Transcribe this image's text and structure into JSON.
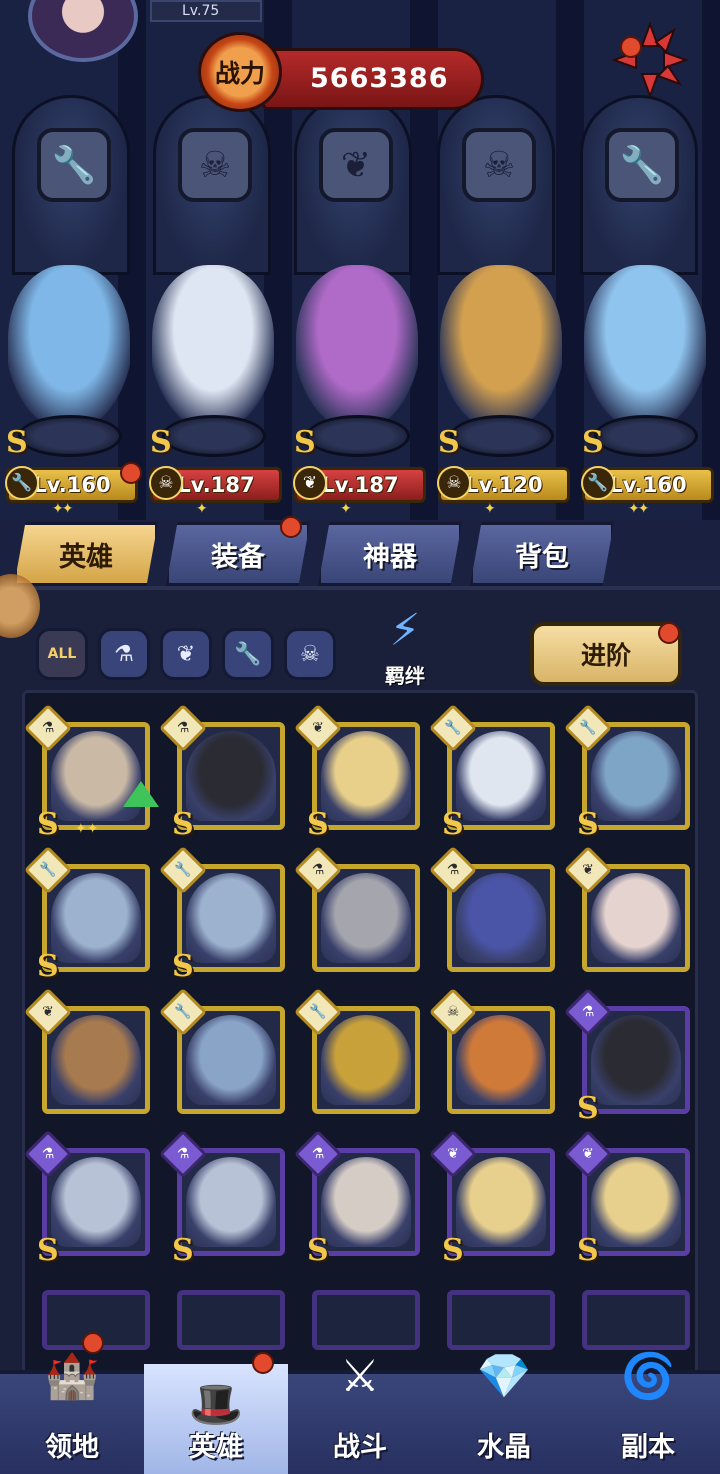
{
  "player": {
    "level": "Lv.75"
  },
  "power": {
    "label": "战力",
    "value": "5663386"
  },
  "lineup": [
    {
      "level": "Lv.160",
      "class_icon": "wrench-icon",
      "class_glyph": "🔧",
      "plate": "gold",
      "stars": "✦✦",
      "body_color": "#7fb8e8"
    },
    {
      "level": "Lv.187",
      "class_icon": "beast-mask-icon",
      "class_glyph": "☠",
      "plate": "red",
      "stars": "✦",
      "body_color": "#dfe6f3"
    },
    {
      "level": "Lv.187",
      "class_icon": "wing-icon",
      "class_glyph": "❦",
      "plate": "red",
      "stars": "✦",
      "body_color": "#b06ac8"
    },
    {
      "level": "Lv.120",
      "class_icon": "beast-mask-icon",
      "class_glyph": "☠",
      "plate": "gold",
      "stars": "✦",
      "body_color": "#d3a050"
    },
    {
      "level": "Lv.160",
      "class_icon": "wrench-icon",
      "class_glyph": "🔧",
      "plate": "gold",
      "stars": "✦✦",
      "body_color": "#8fc4ee"
    }
  ],
  "tabs": [
    {
      "label": "英雄",
      "active": true
    },
    {
      "label": "装备",
      "active": false
    },
    {
      "label": "神器",
      "active": false
    },
    {
      "label": "背包",
      "active": false
    }
  ],
  "filters": [
    {
      "icon": "all-filter-icon",
      "glyph": "ALL"
    },
    {
      "icon": "flask-filter-icon",
      "glyph": "⚗"
    },
    {
      "icon": "wing-filter-icon",
      "glyph": "❦"
    },
    {
      "icon": "wrench-filter-icon",
      "glyph": "🔧"
    },
    {
      "icon": "beast-filter-icon",
      "glyph": "☠"
    }
  ],
  "bond": {
    "label": "羁绊"
  },
  "advance": {
    "label": "进阶"
  },
  "heroes": [
    {
      "class": "flask",
      "tier": "gold",
      "s": true,
      "stars": "✦✦",
      "upgrade": true,
      "color": "#c9b9a5"
    },
    {
      "class": "flask",
      "tier": "gold",
      "s": true,
      "stars": "",
      "upgrade": false,
      "color": "#2b2b33"
    },
    {
      "class": "wing",
      "tier": "gold",
      "s": true,
      "stars": "",
      "upgrade": false,
      "color": "#e8cf8a"
    },
    {
      "class": "wrench",
      "tier": "gold",
      "s": true,
      "stars": "",
      "upgrade": false,
      "color": "#dfe6ef"
    },
    {
      "class": "wrench",
      "tier": "gold",
      "s": true,
      "stars": "",
      "upgrade": false,
      "color": "#7ea4c6"
    },
    {
      "class": "wrench",
      "tier": "gold",
      "s": true,
      "stars": "",
      "upgrade": false,
      "color": "#9cb2cf"
    },
    {
      "class": "wrench",
      "tier": "gold",
      "s": true,
      "stars": "",
      "upgrade": false,
      "color": "#9cb2cf"
    },
    {
      "class": "flask",
      "tier": "gold",
      "s": false,
      "stars": "",
      "upgrade": false,
      "color": "#a5a5ad"
    },
    {
      "class": "flask",
      "tier": "gold",
      "s": false,
      "stars": "",
      "upgrade": false,
      "color": "#4b55a8"
    },
    {
      "class": "wing",
      "tier": "gold",
      "s": false,
      "stars": "",
      "upgrade": false,
      "color": "#e5d3cf"
    },
    {
      "class": "wing",
      "tier": "gold",
      "s": false,
      "stars": "",
      "upgrade": false,
      "color": "#a77a4f"
    },
    {
      "class": "wrench",
      "tier": "gold",
      "s": false,
      "stars": "",
      "upgrade": false,
      "color": "#8aa4c8"
    },
    {
      "class": "wrench",
      "tier": "gold",
      "s": false,
      "stars": "",
      "upgrade": false,
      "color": "#c9a13a"
    },
    {
      "class": "beast",
      "tier": "gold",
      "s": false,
      "stars": "",
      "upgrade": false,
      "color": "#d07a3a"
    },
    {
      "class": "flask",
      "tier": "purple",
      "s": true,
      "stars": "",
      "upgrade": false,
      "color": "#2b2b33"
    },
    {
      "class": "flask",
      "tier": "purple",
      "s": true,
      "stars": "",
      "upgrade": false,
      "color": "#b7c2d6"
    },
    {
      "class": "flask",
      "tier": "purple",
      "s": true,
      "stars": "",
      "upgrade": false,
      "color": "#b7c2d6"
    },
    {
      "class": "flask",
      "tier": "purple",
      "s": true,
      "stars": "",
      "upgrade": false,
      "color": "#d5ccc6"
    },
    {
      "class": "wing",
      "tier": "purple",
      "s": true,
      "stars": "",
      "upgrade": false,
      "color": "#e7cf8d"
    },
    {
      "class": "wing",
      "tier": "purple",
      "s": true,
      "stars": "",
      "upgrade": false,
      "color": "#e7cf8d"
    }
  ],
  "nav": [
    {
      "label": "领地",
      "icon": "castle-icon",
      "glyph": "🏰",
      "active": false,
      "badge": true
    },
    {
      "label": "英雄",
      "icon": "wizard-hat-icon",
      "glyph": "🎩",
      "active": true,
      "badge": true
    },
    {
      "label": "战斗",
      "icon": "battle-icon",
      "glyph": "⚔",
      "active": false,
      "badge": false
    },
    {
      "label": "水晶",
      "icon": "crystal-icon",
      "glyph": "💎",
      "active": false,
      "badge": false
    },
    {
      "label": "副本",
      "icon": "dungeon-portal-icon",
      "glyph": "🌀",
      "active": false,
      "badge": false
    }
  ]
}
